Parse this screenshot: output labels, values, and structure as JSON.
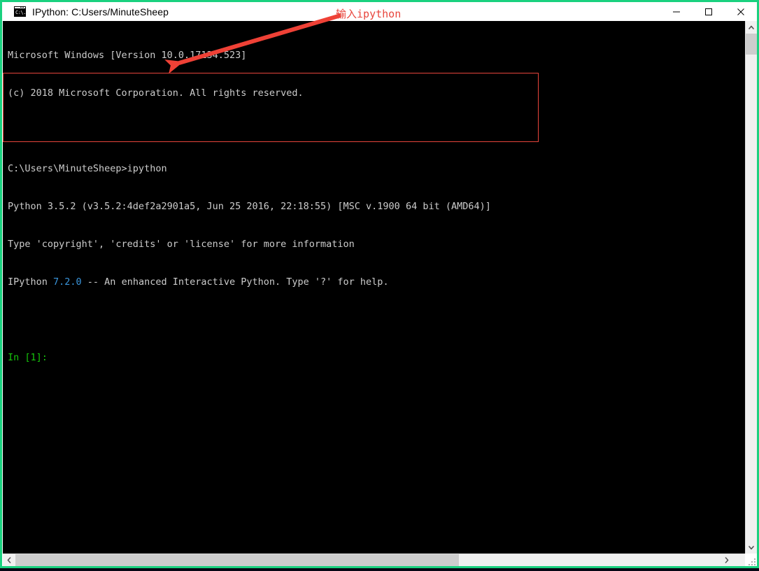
{
  "window": {
    "title": "IPython: C:Users/MinuteSheep",
    "icon_name": "cmd-icon",
    "icon_glyph": "C:\\.",
    "border_color": "#1ad17f",
    "controls": {
      "minimize_label": "Minimize",
      "maximize_label": "Maximize",
      "close_label": "Close"
    }
  },
  "console": {
    "background": "#000000",
    "default_text_color": "#cccccc",
    "prompt_color": "#16c60c",
    "version_color": "#3a96dd",
    "lines": [
      {
        "id": "l1",
        "text": "Microsoft Windows [Version 10.0.17134.523]"
      },
      {
        "id": "l2",
        "text": "(c) 2018 Microsoft Corporation. All rights reserved."
      },
      {
        "id": "l3",
        "text": ""
      },
      {
        "id": "l4",
        "text": "C:\\Users\\MinuteSheep>ipython"
      },
      {
        "id": "l5",
        "text": "Python 3.5.2 (v3.5.2:4def2a2901a5, Jun 25 2016, 22:18:55) [MSC v.1900 64 bit (AMD64)]"
      },
      {
        "id": "l6",
        "text": "Type 'copyright', 'credits' or 'license' for more information"
      },
      {
        "id": "l7a",
        "text": "IPython "
      },
      {
        "id": "l7b",
        "text": "7.2.0"
      },
      {
        "id": "l7c",
        "text": " -- An enhanced Interactive Python. Type '?' for help."
      },
      {
        "id": "l8",
        "text": ""
      },
      {
        "id": "l9",
        "text": "In [1]:"
      }
    ]
  },
  "annotations": {
    "callout_text_cjk": "输入",
    "callout_text_cmd": "ipython",
    "callout_color": "#e8453c",
    "arrow_color": "#ef4136",
    "highlight_box_color": "#e8453c"
  },
  "scrollbars": {
    "vertical": {
      "up_arrow": "▲",
      "down_arrow": "▼",
      "thumb_position_percent": 2
    },
    "horizontal": {
      "left_arrow": "❮",
      "right_arrow": "❯",
      "thumb_position_percent": 0
    }
  }
}
